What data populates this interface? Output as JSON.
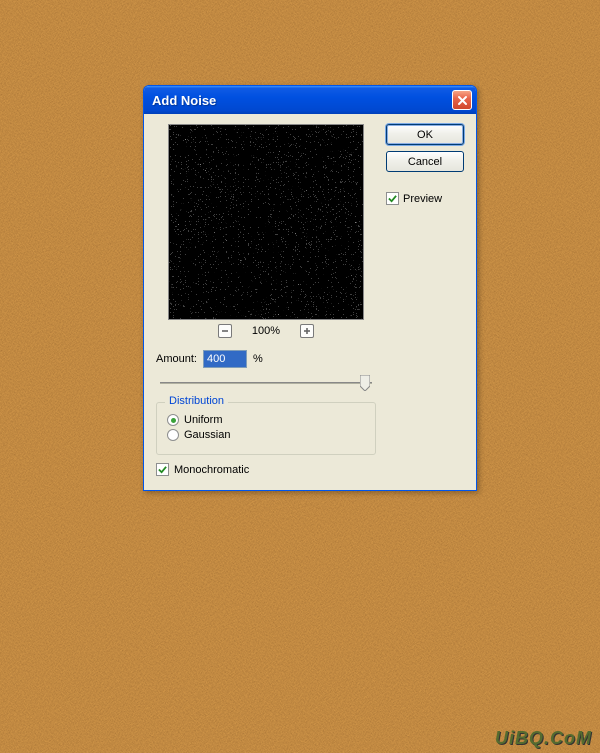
{
  "dialog": {
    "title": "Add Noise",
    "ok_label": "OK",
    "cancel_label": "Cancel",
    "preview_label": "Preview",
    "preview_checked": true,
    "zoom_level": "100%",
    "amount_label": "Amount:",
    "amount_value": "400",
    "amount_unit": "%",
    "distribution": {
      "legend": "Distribution",
      "uniform_label": "Uniform",
      "gaussian_label": "Gaussian",
      "selected": "uniform"
    },
    "monochromatic_label": "Monochromatic",
    "monochromatic_checked": true
  },
  "watermark": "UiBQ.CoM"
}
